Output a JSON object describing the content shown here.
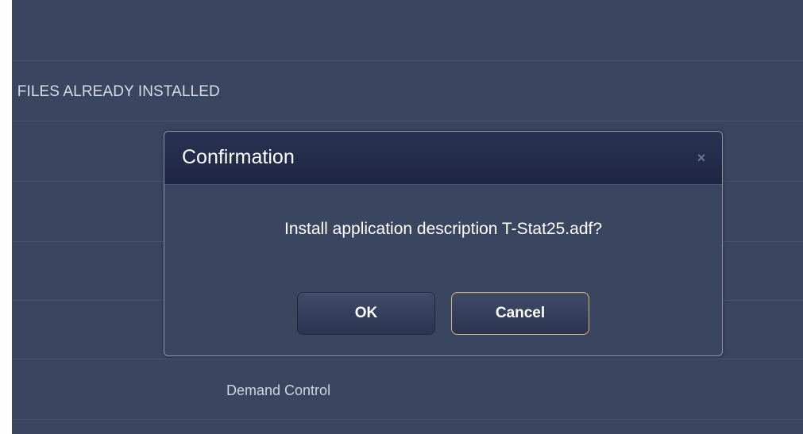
{
  "background": {
    "rows": {
      "header_text": "I FILES ALREADY INSTALLED",
      "item_text": "Demand Control"
    }
  },
  "dialog": {
    "title": "Confirmation",
    "close_icon": "close-icon",
    "message": "Install application description T-Stat25.adf?",
    "buttons": {
      "ok": "OK",
      "cancel": "Cancel"
    }
  },
  "colors": {
    "panel_background": "#3a4560",
    "dialog_header": "#1e2644",
    "focus_border": "#d6b678",
    "text": "#ffffff"
  }
}
